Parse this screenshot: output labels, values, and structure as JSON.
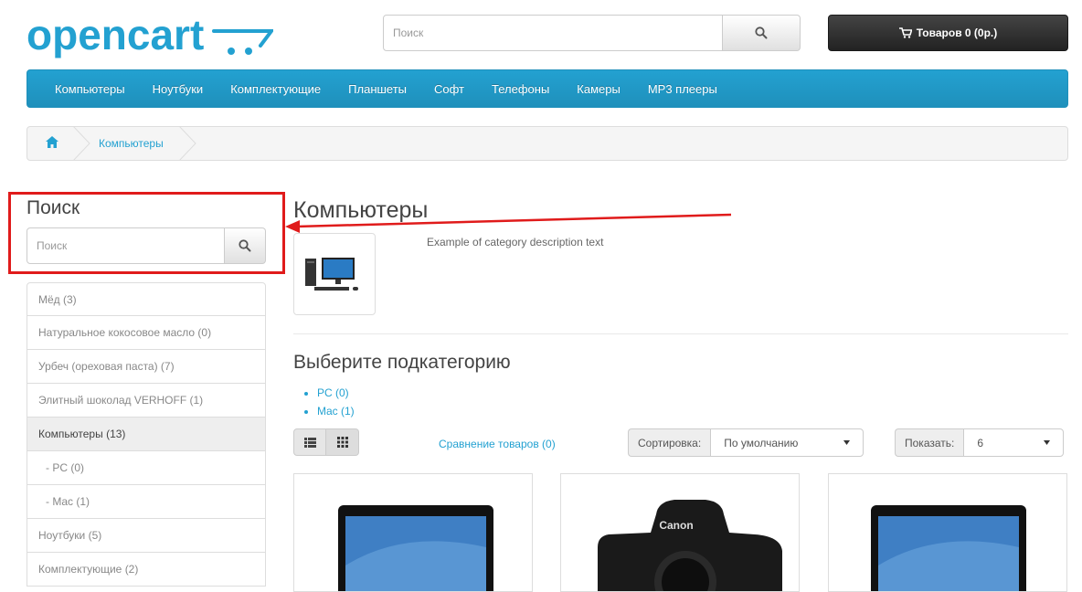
{
  "header": {
    "logo_text": "opencart",
    "search_placeholder": "Поиск",
    "cart_label": "Товаров 0 (0р.)"
  },
  "menu": [
    "Компьютеры",
    "Ноутбуки",
    "Комплектующие",
    "Планшеты",
    "Софт",
    "Телефоны",
    "Камеры",
    "MP3 плееры"
  ],
  "breadcrumb": {
    "item": "Компьютеры"
  },
  "sidebar": {
    "title": "Поиск",
    "search_placeholder": "Поиск",
    "categories": [
      "Мёд (3)",
      "Натуральное кокосовое масло (0)",
      "Урбеч (ореховая паста) (7)",
      "Элитный шоколад VERHOFF (1)",
      "Компьютеры (13)",
      "- PC (0)",
      "- Mac (1)",
      "Ноутбуки (5)",
      "Комплектующие (2)"
    ],
    "active_index": 4
  },
  "content": {
    "title": "Компьютеры",
    "description": "Example of category description text",
    "subcategory_title": "Выберите подкатегорию",
    "subcategories": [
      "PC (0)",
      "Mac (1)"
    ],
    "compare_link": "Сравнение товаров (0)",
    "sort_label": "Сортировка:",
    "sort_value": "По умолчанию",
    "limit_label": "Показать:",
    "limit_value": "6"
  },
  "colors": {
    "accent": "#23a1d1",
    "highlight": "#e01b1b"
  }
}
